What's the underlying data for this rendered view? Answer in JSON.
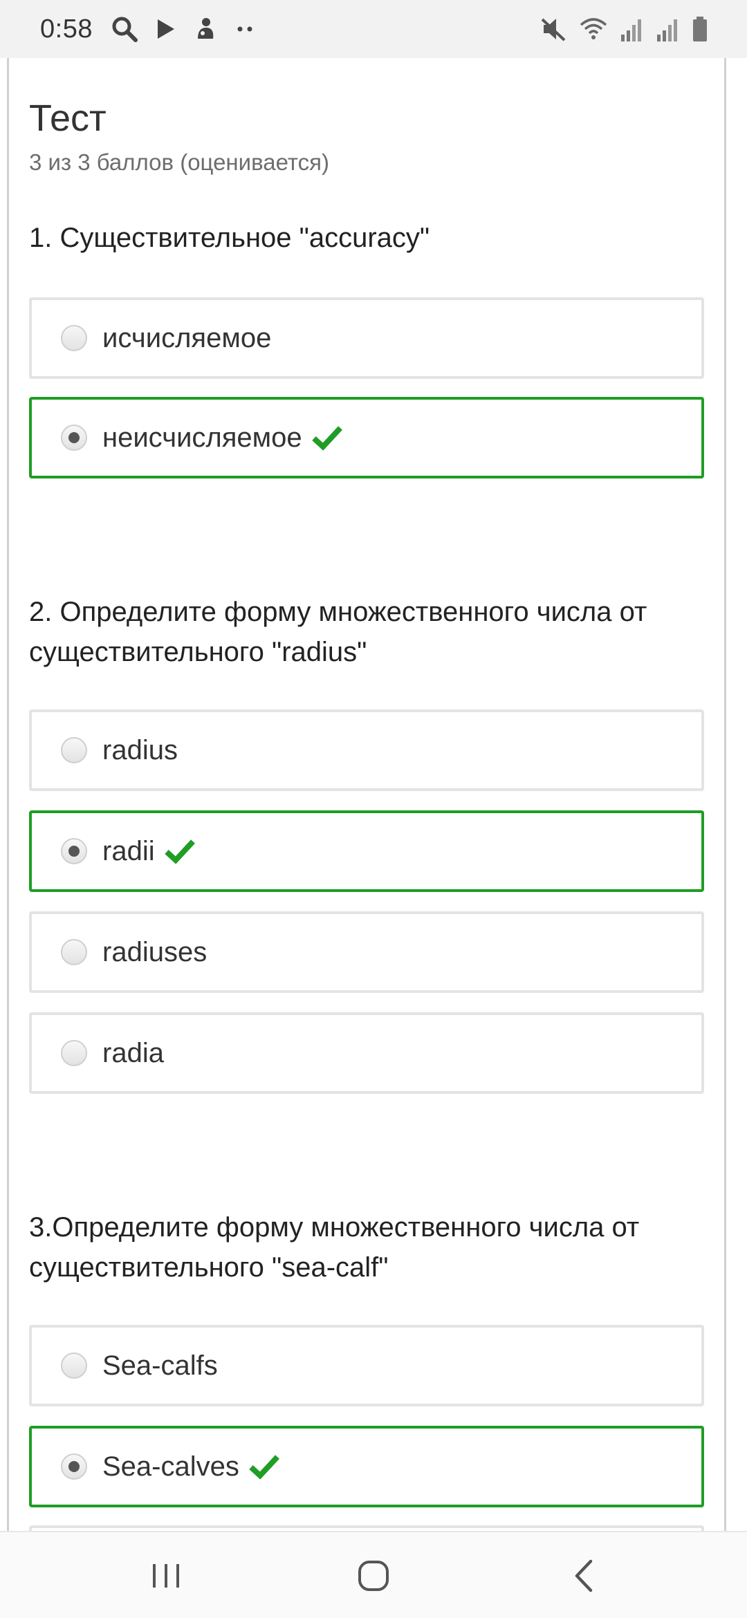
{
  "status_bar": {
    "time": "0:58",
    "left_icons": [
      "search-icon",
      "play-icon",
      "app-icon",
      "more-dots-icon"
    ],
    "right_icons": [
      "mute-icon",
      "wifi-icon",
      "signal-icon",
      "signal-icon",
      "battery-icon"
    ]
  },
  "page": {
    "title": "Тест",
    "score": "3 из 3 баллов (оценивается)"
  },
  "questions": [
    {
      "text": "1. Существительное \"accuracy\"",
      "options": [
        {
          "label": "исчисляемое",
          "selected": false,
          "correct": false
        },
        {
          "label": "неисчисляемое",
          "selected": true,
          "correct": true
        }
      ]
    },
    {
      "text": "2. Определите форму множественного числа от существительного \"radius\"",
      "options": [
        {
          "label": "radius",
          "selected": false,
          "correct": false
        },
        {
          "label": "radii",
          "selected": true,
          "correct": true
        },
        {
          "label": "radiuses",
          "selected": false,
          "correct": false
        },
        {
          "label": "radia",
          "selected": false,
          "correct": false
        }
      ]
    },
    {
      "text": "3.Определите форму множественного числа от существительного \"sea-calf\"",
      "options": [
        {
          "label": "Sea-calfs",
          "selected": false,
          "correct": false
        },
        {
          "label": "Sea-calves",
          "selected": true,
          "correct": true
        }
      ]
    }
  ],
  "nav_bar": {
    "buttons": [
      "recent-apps-icon",
      "home-icon",
      "back-icon"
    ]
  },
  "colors": {
    "correct": "#1f9d24",
    "option_border": "#e3e3e3",
    "status_bar_bg": "#f2f2f2"
  }
}
